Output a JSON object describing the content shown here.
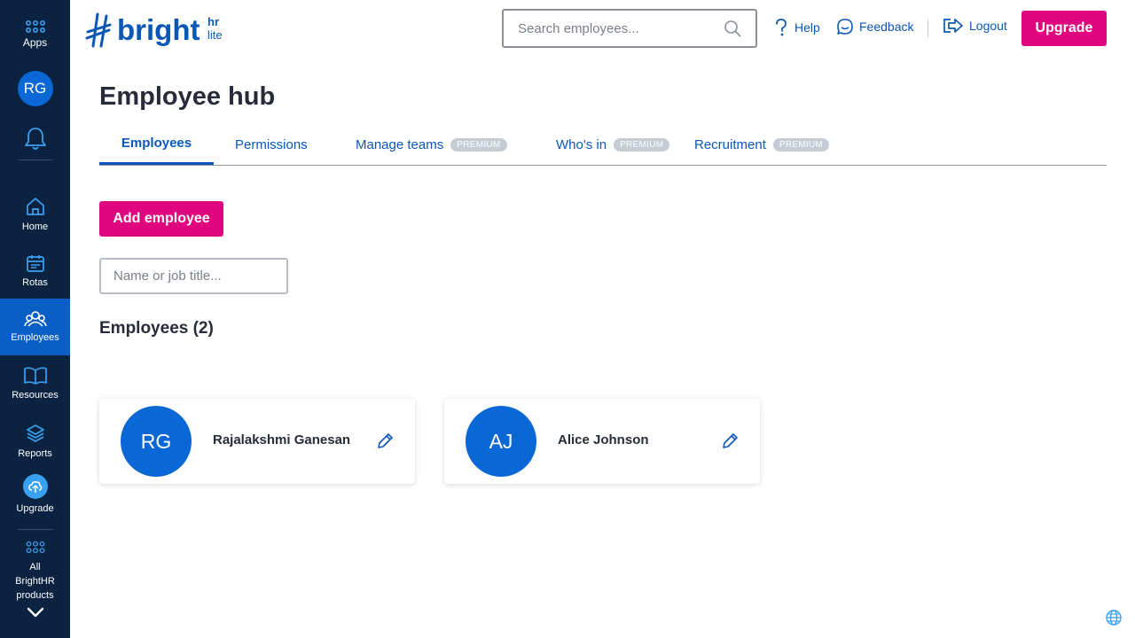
{
  "app": {
    "brand": "bright",
    "brand_sup": "hr",
    "brand_sub": "lite"
  },
  "sidebar": {
    "apps_label": "Apps",
    "user_initials": "RG",
    "items": [
      {
        "label": "Home",
        "icon": "home-icon"
      },
      {
        "label": "Rotas",
        "icon": "calendar-icon"
      },
      {
        "label": "Employees",
        "icon": "people-icon",
        "active": true
      },
      {
        "label": "Resources",
        "icon": "book-icon"
      },
      {
        "label": "Reports",
        "icon": "layers-icon"
      },
      {
        "label": "Upgrade",
        "icon": "upload-icon"
      }
    ],
    "all_products_line1": "All",
    "all_products_line2": "BrightHR",
    "all_products_line3": "products"
  },
  "header": {
    "search_placeholder": "Search employees...",
    "help": "Help",
    "feedback": "Feedback",
    "logout": "Logout",
    "upgrade": "Upgrade"
  },
  "main": {
    "title": "Employee hub",
    "tabs": [
      {
        "label": "Employees",
        "active": true
      },
      {
        "label": "Permissions"
      },
      {
        "label": "Manage teams",
        "badge": "PREMIUM"
      },
      {
        "label": "Who's in",
        "badge": "PREMIUM"
      },
      {
        "label": "Recruitment",
        "badge": "PREMIUM"
      }
    ],
    "add_button": "Add employee",
    "filter_placeholder": "Name or job title...",
    "section_title": "Employees (2)",
    "employees": [
      {
        "initials": "RG",
        "name": "Rajalakshmi Ganesan"
      },
      {
        "initials": "AJ",
        "name": "Alice Johnson"
      }
    ]
  },
  "colors": {
    "accent": "#e0057f",
    "brand_blue": "#0b57b6",
    "avatar_blue": "#0a67d6",
    "sidebar_bg": "#0b2340"
  }
}
